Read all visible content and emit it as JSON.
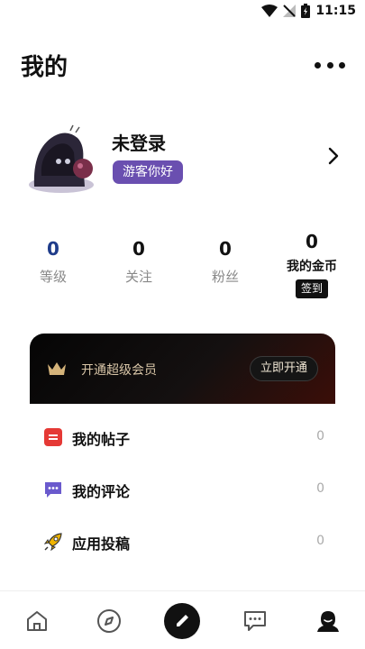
{
  "status_bar": {
    "time": "11:15"
  },
  "header": {
    "title": "我的"
  },
  "profile": {
    "name": "未登录",
    "badge": "游客你好"
  },
  "stats": [
    {
      "value": "0",
      "label": "等级"
    },
    {
      "value": "0",
      "label": "关注"
    },
    {
      "value": "0",
      "label": "粉丝"
    },
    {
      "value": "0",
      "label": "我的金币",
      "action": "签到"
    }
  ],
  "vip": {
    "label": "开通超级会员",
    "button": "立即开通"
  },
  "menu": [
    {
      "label": "我的帖子",
      "count": "0",
      "icon": "posts-icon"
    },
    {
      "label": "我的评论",
      "count": "0",
      "icon": "comments-icon"
    },
    {
      "label": "应用投稿",
      "count": "0",
      "icon": "submit-rocket-icon"
    }
  ],
  "tabs": [
    "home-icon",
    "discover-compass-icon",
    "publish-pen-icon",
    "messages-icon",
    "profile-icon"
  ],
  "colors": {
    "badge": "#6a4fb0",
    "level_value": "#1f3c8a",
    "posts_icon": "#e53935",
    "comments_icon": "#6a5acd",
    "rocket_icon": "#f0b400"
  }
}
